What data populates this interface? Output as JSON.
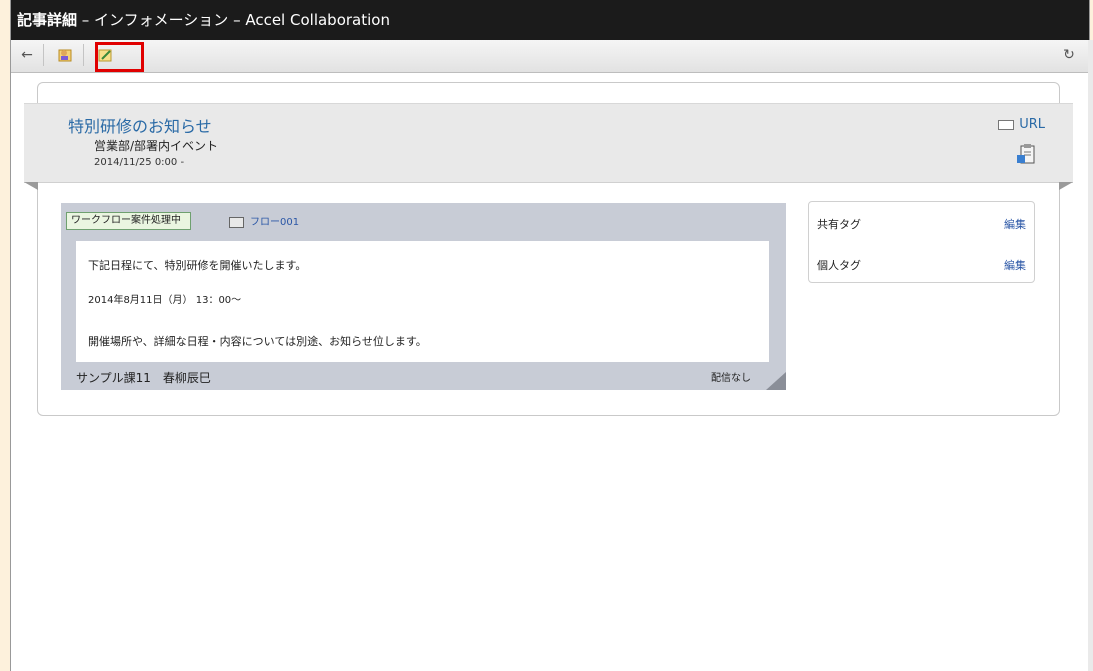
{
  "window": {
    "title_main": "記事詳細",
    "title_rest": " – インフォメーション – Accel Collaboration"
  },
  "toolbar": {
    "back_label": "←",
    "refresh_label": "↻"
  },
  "article": {
    "title": "特別研修のお知らせ",
    "category": "営業部/部署内イベント",
    "date": "2014/11/25 0:00 -",
    "url_label": "URL",
    "workflow_status": "ワークフロー案件処理中",
    "flow_label": "フロー001",
    "body_lines": [
      "下記日程にて、特別研修を開催いたします。",
      "2014年8月11日（月） 13：00～",
      "開催場所や、詳細な日程・内容については別途、お知らせ位します。"
    ],
    "author": "サンプル課11　春柳辰巳",
    "delivery": "配信なし"
  },
  "tags": {
    "shared_label": "共有タグ",
    "personal_label": "個人タグ",
    "edit_label": "編集"
  },
  "colors": {
    "title_link": "#2a6aa6",
    "highlight": "#e00000",
    "titlebar_bg": "#1b1b1b"
  }
}
